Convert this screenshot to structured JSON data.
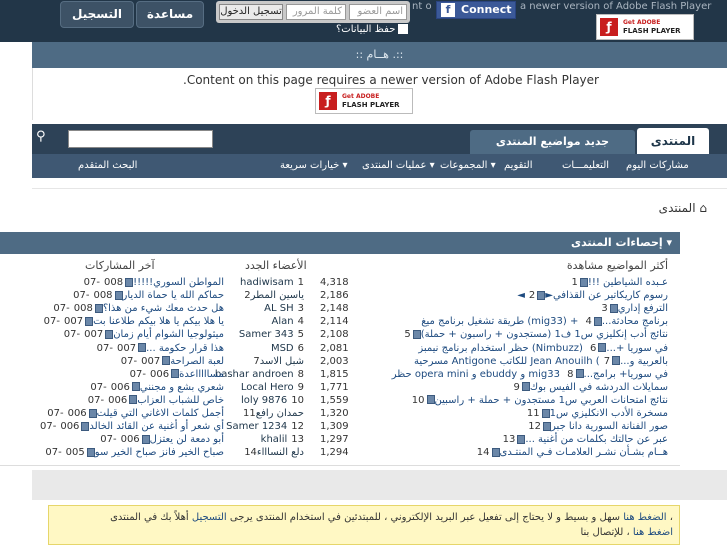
{
  "header": {
    "register_label": "التسجيل",
    "help_label": "مساعدة",
    "login_button": "تسجيل الدخول",
    "password_placeholder": "كلمة المرور",
    "username_placeholder": "اسم العضو",
    "remember_label": "حفظ البيانات؟",
    "connect_label": "Connect",
    "newer_version_text": "a newer version of Adobe Flash Player",
    "flash_get": "Get ADOBE",
    "flash_player": "FLASH PLAYER",
    "facebook_letter": "f"
  },
  "announcement": {
    "title": ":: هــام .::"
  },
  "flash_message": {
    "text": ".Content on this page requires a newer version of Adobe Flash Player"
  },
  "navbar": {
    "tab_forum": "المنتدى",
    "tab_new_posts": "جديد مواضيع المنتدى",
    "search_placeholder": "",
    "advanced_search": "البحث المتقدم",
    "subnav": [
      "مشاركات اليوم",
      "التعليمـــات",
      "التقويم",
      "المجموعات ▾",
      "عمليات المنتدى ▾",
      "خيارات سريعة ▾"
    ]
  },
  "breadcrumb": {
    "label": "المنتدى"
  },
  "stats": {
    "title": "إحصاءات المنتدى ▾",
    "col_topics": "أكثر المواضيع مشاهدة",
    "col_members": "الأعضاء الجدد",
    "col_posts": "آخر المشاركات",
    "topics": [
      {
        "n": "1",
        "title": "عـبده الشياطين !!!",
        "views": "4,318"
      },
      {
        "n": "2",
        "title": "◄رسوم كاريكاتير عن القذافي►",
        "views": "2,186"
      },
      {
        "n": "3",
        "title": "الترفع إداري",
        "views": "2,148"
      },
      {
        "n": "4",
        "title": "طريقة تشغيل برنامج ميغ (mig33) + برنامج محادثة...",
        "views": "2,114"
      },
      {
        "n": "5",
        "title": "نتائج أدب إنكليزي س1 ف1 (مستجدون + راسبون + حملة)",
        "views": "2,108"
      },
      {
        "n": "6",
        "title": "حظر استخدام برنامج نيمبز (Nimbuzz) في سوريا +...",
        "views": "2,081"
      },
      {
        "n": "7",
        "title": "مسرحية Antigone للكاتب Jean Anouilh (بالعربية و...",
        "views": "2,003"
      },
      {
        "n": "8",
        "title": "حظر opera mini و ebuddy و mig33 في سوريا+ برامج...",
        "views": "1,815"
      },
      {
        "n": "9",
        "title": "سمايلات الدردشه في الفيس بوك",
        "views": "1,771"
      },
      {
        "n": "10",
        "title": "نتائج امتحانات العربي س1 مستجدون + حملة + راسبين",
        "views": "1,559"
      },
      {
        "n": "11",
        "title": "مسخرة الأدب الانكليزي س1",
        "views": "1,320"
      },
      {
        "n": "12",
        "title": "صور الفنانة السورية دانا جبر",
        "views": "1,309"
      },
      {
        "n": "13",
        "title": "عبر عن حالتك بكلمات من أغنية ...",
        "views": "1,297"
      },
      {
        "n": "14",
        "title": "هــام بشـأن نشـر العلامـات فـي المنتـدى",
        "views": "1,294"
      }
    ],
    "members": [
      {
        "n": "1",
        "name": "hadiwisam"
      },
      {
        "n": "2",
        "name": "ياسين المطر"
      },
      {
        "n": "3",
        "name": "AL SH"
      },
      {
        "n": "4",
        "name": "Alan"
      },
      {
        "n": "5",
        "name": "Samer 343"
      },
      {
        "n": "6",
        "name": "MSD"
      },
      {
        "n": "7",
        "name": "شبل الاسد"
      },
      {
        "n": "8",
        "name": "bashar androen"
      },
      {
        "n": "9",
        "name": "Local Hero"
      },
      {
        "n": "10",
        "name": "loly 9876"
      },
      {
        "n": "11",
        "name": "حمدان رافع"
      },
      {
        "n": "12",
        "name": "Samer 1234"
      },
      {
        "n": "13",
        "name": "khalil"
      },
      {
        "n": "14",
        "name": "دلع النساااء"
      }
    ],
    "posts": [
      {
        "date": "08-07",
        "count": "0",
        "title": "المواطن السوري!!!!!"
      },
      {
        "date": "08-07",
        "count": "0",
        "title": "حماكم الله يا حماة الديار"
      },
      {
        "date": "08-07",
        "count": "0",
        "title": "هل حدث معك شيء من هذا؟"
      },
      {
        "date": "07-07",
        "count": "0",
        "title": "يا هلا بيكم يا هلا بيكم طلاعنا بت"
      },
      {
        "date": "07-07",
        "count": "0",
        "title": "ميثولوجيا الشوام أيام زمان"
      },
      {
        "date": "07-07",
        "count": "0",
        "title": "هذا قرار حكومة ..."
      },
      {
        "date": "07-07",
        "count": "0",
        "title": "لعبة الصراحة"
      },
      {
        "date": "06-07",
        "count": "0",
        "title": "مساااااعدة"
      },
      {
        "date": "06-07",
        "count": "0",
        "title": "شعري بشع و مجنني"
      },
      {
        "date": "06-07",
        "count": "0",
        "title": "خاص للشباب العزاب"
      },
      {
        "date": "06-07",
        "count": "0",
        "title": "أجمل كلمات الاغاني التي قيلت"
      },
      {
        "date": "06-07",
        "count": "0",
        "title": "أي شعر أو أغنية عن القائد الخالد"
      },
      {
        "date": "06-07",
        "count": "0",
        "title": "أبو دمعة لن يعتزل"
      },
      {
        "date": "05-07",
        "count": "0",
        "title": "صباح الخير فانز صباح الخير سو"
      }
    ]
  },
  "notice": {
    "line1_a": "أهلاً بك في المنتدى ،",
    "line1_link": "التسجيل",
    "line1_b": "سهل و بسيط و لا يحتاج إلى تفعيل عبر البريد الإلكتروني ، للمبتدئين في استخدام المنتدى يرجى",
    "line1_link2": "الضغط هنا",
    "line2_a": "، للإتصال بنا",
    "line2_link": "اضغط هنا"
  },
  "colors": {
    "header_bg": "#223648",
    "nav_bg": "#2d4257",
    "accent": "#4e6b84",
    "notice_bg": "#fff8c4"
  }
}
